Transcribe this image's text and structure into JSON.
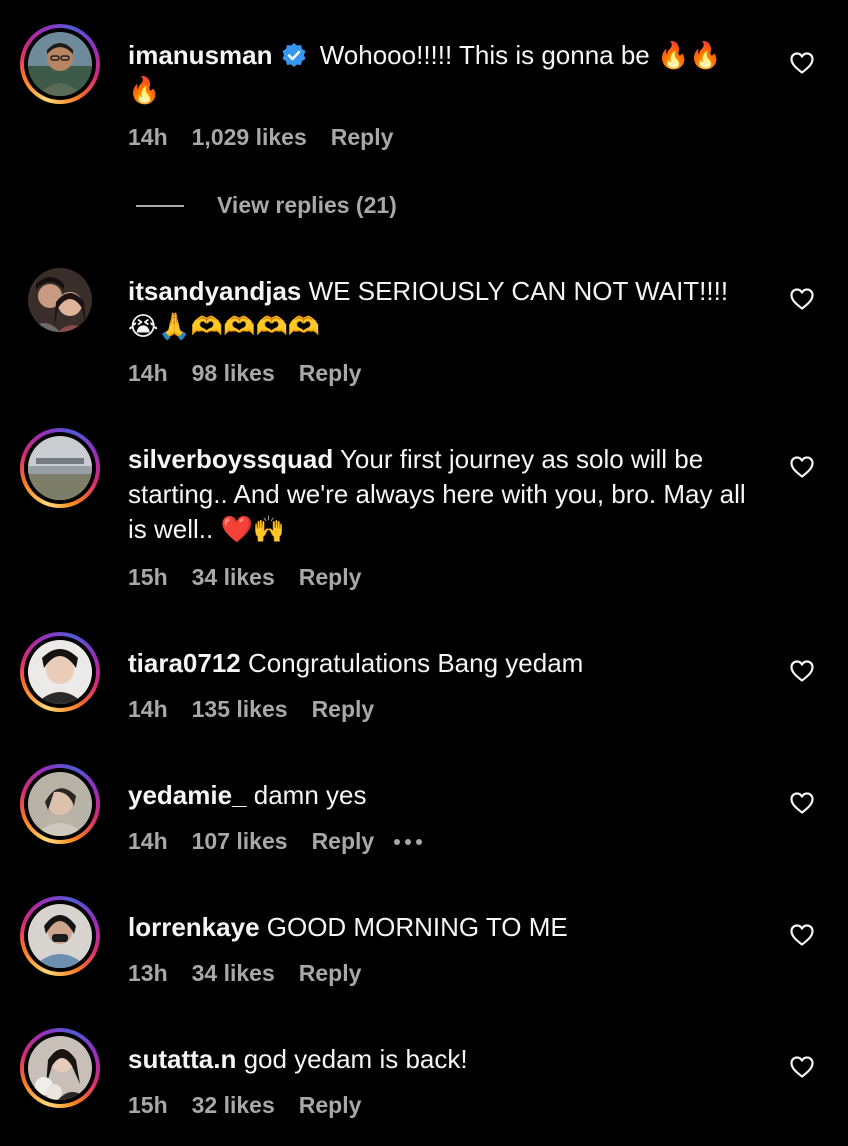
{
  "comments": [
    {
      "username": "imanusman",
      "verified": true,
      "text": "Wohooo!!!!! This is gonna be 🔥🔥🔥",
      "age": "14h",
      "likes": "1,029 likes",
      "reply": "Reply",
      "view_replies": "View replies (21)",
      "avatar_icon": "avatar-photo",
      "heart_icon": "heart-outline-icon"
    },
    {
      "username": "itsandyandjas",
      "text": "WE SERIOUSLY CAN NOT WAIT!!!!😭🙏🫶🫶🫶🫶",
      "age": "14h",
      "likes": "98 likes",
      "reply": "Reply"
    },
    {
      "username": "silverboyssquad",
      "text": "Your first journey as solo will be starting.. And we're always here with you, bro. May all is well.. ❤️🙌",
      "age": "15h",
      "likes": "34 likes",
      "reply": "Reply"
    },
    {
      "username": "tiara0712",
      "text": "Congratulations Bang yedam",
      "age": "14h",
      "likes": "135 likes",
      "reply": "Reply"
    },
    {
      "username": "yedamie_",
      "text": "damn yes",
      "age": "14h",
      "likes": "107 likes",
      "reply": "Reply"
    },
    {
      "username": "lorrenkaye",
      "text": "GOOD MORNING TO ME",
      "age": "13h",
      "likes": "34 likes",
      "reply": "Reply"
    },
    {
      "username": "sutatta.n",
      "text": "god yedam is back!",
      "age": "15h",
      "likes": "32 likes",
      "reply": "Reply"
    }
  ],
  "colors": {
    "background": "#000000",
    "text": "#f5f5f5",
    "secondary": "#a8a8a8",
    "verified": "#3897f0"
  }
}
